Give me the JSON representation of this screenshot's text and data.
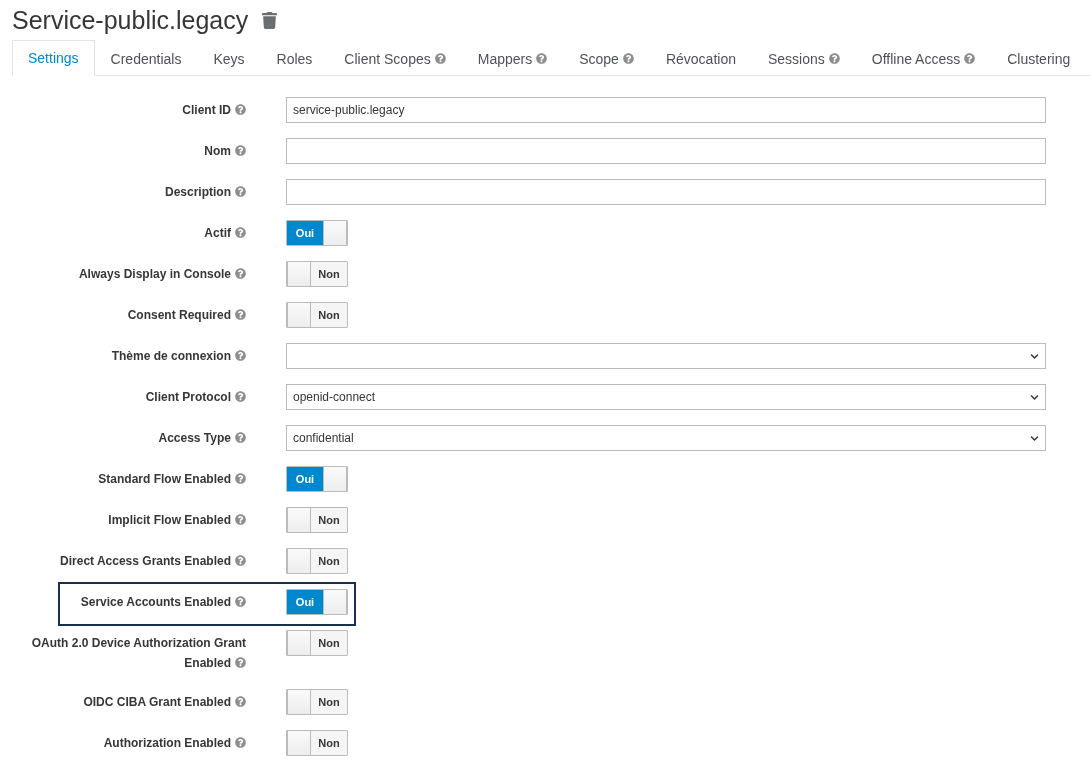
{
  "title": "Service-public.legacy",
  "tabs": [
    {
      "label": "Settings",
      "help": false,
      "selected": true
    },
    {
      "label": "Credentials",
      "help": false,
      "selected": false
    },
    {
      "label": "Keys",
      "help": false,
      "selected": false
    },
    {
      "label": "Roles",
      "help": false,
      "selected": false
    },
    {
      "label": "Client Scopes",
      "help": true,
      "selected": false
    },
    {
      "label": "Mappers",
      "help": true,
      "selected": false
    },
    {
      "label": "Scope",
      "help": true,
      "selected": false
    },
    {
      "label": "Révocation",
      "help": false,
      "selected": false
    },
    {
      "label": "Sessions",
      "help": true,
      "selected": false
    },
    {
      "label": "Offline Access",
      "help": true,
      "selected": false
    },
    {
      "label": "Clustering",
      "help": false,
      "selected": false
    }
  ],
  "fields": [
    {
      "kind": "text",
      "label": "Client ID",
      "value": "service-public.legacy"
    },
    {
      "kind": "text",
      "label": "Nom"
    },
    {
      "kind": "text",
      "label": "Description"
    },
    {
      "kind": "toggle",
      "label": "Actif",
      "on": true,
      "text": "Oui"
    },
    {
      "kind": "toggle",
      "label": "Always Display in Console",
      "on": false,
      "text": "Non"
    },
    {
      "kind": "toggle",
      "label": "Consent Required",
      "on": false,
      "text": "Non"
    },
    {
      "kind": "select",
      "label": "Thème de connexion"
    },
    {
      "kind": "select",
      "label": "Client Protocol",
      "value": "openid-connect"
    },
    {
      "kind": "select",
      "label": "Access Type",
      "value": "confidential"
    },
    {
      "kind": "toggle",
      "label": "Standard Flow Enabled",
      "on": true,
      "text": "Oui"
    },
    {
      "kind": "toggle",
      "label": "Implicit Flow Enabled",
      "on": false,
      "text": "Non"
    },
    {
      "kind": "toggle",
      "label": "Direct Access Grants Enabled",
      "on": false,
      "text": "Non"
    },
    {
      "kind": "toggle",
      "label": "Service Accounts Enabled",
      "on": true,
      "text": "Oui",
      "highlighted": true
    },
    {
      "kind": "toggle",
      "label": "OAuth 2.0 Device Authorization Grant Enabled",
      "on": false,
      "text": "Non"
    },
    {
      "kind": "toggle",
      "label": "OIDC CIBA Grant Enabled",
      "on": false,
      "text": "Non"
    },
    {
      "kind": "toggle",
      "label": "Authorization Enabled",
      "on": false,
      "text": "Non"
    }
  ]
}
